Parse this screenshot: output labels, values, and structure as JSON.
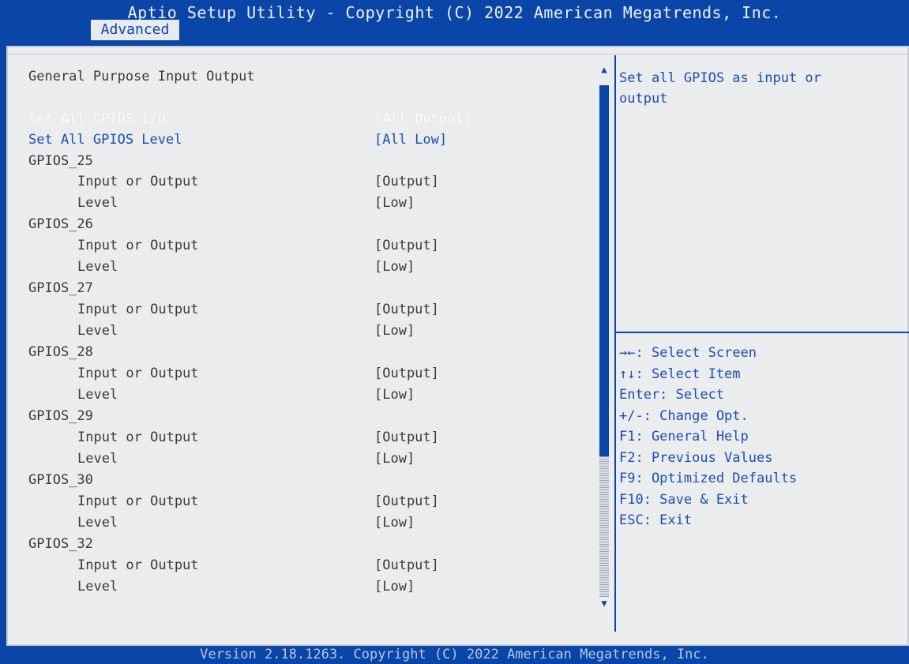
{
  "header": {
    "title": "Aptio Setup Utility - Copyright (C) 2022 American Megatrends, Inc.",
    "tab": "Advanced"
  },
  "main": {
    "section_title": "General Purpose Input Output",
    "set_all_io": {
      "label": "Set All GPIOS I/O",
      "value": "[All Output]"
    },
    "set_all_level": {
      "label": "Set All GPIOS Level",
      "value": "[All Low]"
    },
    "gpios": [
      {
        "name": "GPIOS_25",
        "io_label": "Input or Output",
        "io_value": "[Output]",
        "level_label": "Level",
        "level_value": "[Low]"
      },
      {
        "name": "GPIOS_26",
        "io_label": "Input or Output",
        "io_value": "[Output]",
        "level_label": "Level",
        "level_value": "[Low]"
      },
      {
        "name": "GPIOS_27",
        "io_label": "Input or Output",
        "io_value": "[Output]",
        "level_label": "Level",
        "level_value": "[Low]"
      },
      {
        "name": "GPIOS_28",
        "io_label": "Input or Output",
        "io_value": "[Output]",
        "level_label": "Level",
        "level_value": "[Low]"
      },
      {
        "name": "GPIOS_29",
        "io_label": "Input or Output",
        "io_value": "[Output]",
        "level_label": "Level",
        "level_value": "[Low]"
      },
      {
        "name": "GPIOS_30",
        "io_label": "Input or Output",
        "io_value": "[Output]",
        "level_label": "Level",
        "level_value": "[Low]"
      },
      {
        "name": "GPIOS_32",
        "io_label": "Input or Output",
        "io_value": "[Output]",
        "level_label": "Level",
        "level_value": "[Low]"
      }
    ]
  },
  "help": {
    "line1": "Set all GPIOS as input or",
    "line2": "output"
  },
  "keys": [
    "→←: Select Screen",
    "↑↓: Select Item",
    "Enter: Select",
    "+/-: Change Opt.",
    "F1: General Help",
    "F2: Previous Values",
    "F9: Optimized Defaults",
    "F10: Save & Exit",
    "ESC: Exit"
  ],
  "footer": "Version 2.18.1263. Copyright (C) 2022 American Megatrends, Inc.",
  "scrollbar": {
    "up_icon": "arrow-up",
    "down_icon": "arrow-down",
    "up_glyph": "▲",
    "down_glyph": "▼"
  },
  "colors": {
    "bios_blue": "#0a46a8",
    "panel_bg": "#ebecee",
    "highlight_text": "#ffffff",
    "option_text": "#1a4fb0",
    "static_text": "#3a3a3a"
  }
}
